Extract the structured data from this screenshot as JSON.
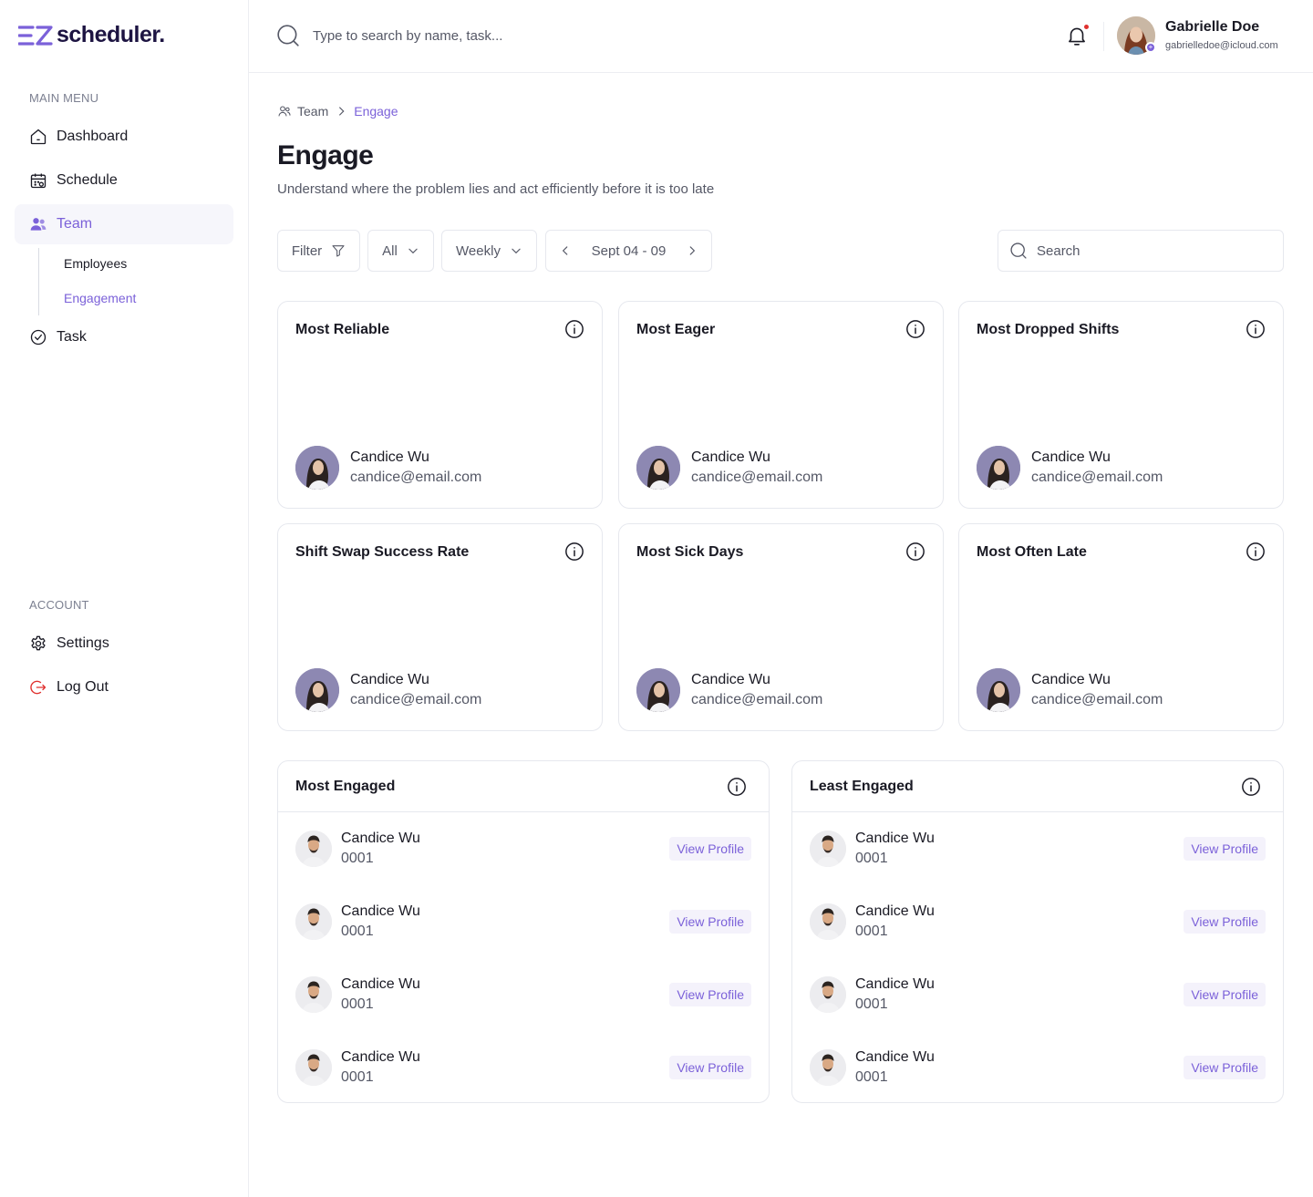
{
  "brand": {
    "name": "scheduler.",
    "accent": "#7b61d9",
    "dark": "#1d1442"
  },
  "sidebar": {
    "main_menu_label": "MAIN MENU",
    "items": [
      {
        "label": "Dashboard",
        "icon": "home-icon"
      },
      {
        "label": "Schedule",
        "icon": "calendar-icon"
      },
      {
        "label": "Team",
        "icon": "users-icon",
        "active": true
      },
      {
        "label": "Task",
        "icon": "check-circle-icon"
      }
    ],
    "team_sub": [
      {
        "label": "Employees"
      },
      {
        "label": "Engagement",
        "active": true
      }
    ],
    "account_label": "ACCOUNT",
    "account_items": [
      {
        "label": "Settings",
        "icon": "gear-icon"
      },
      {
        "label": "Log Out",
        "icon": "logout-icon"
      }
    ]
  },
  "topbar": {
    "search_placeholder": "Type to search by name, task...",
    "user": {
      "name": "Gabrielle Doe",
      "email": "gabrielledoe@icloud.com"
    }
  },
  "breadcrumb": {
    "parent": "Team",
    "current": "Engage"
  },
  "page": {
    "title": "Engage",
    "subtitle": "Understand where the problem lies and act efficiently before it is too late"
  },
  "toolbar": {
    "filter_label": "Filter",
    "group_value": "All",
    "period_value": "Weekly",
    "date_range": "Sept 04 - 09",
    "search_placeholder": "Search"
  },
  "stat_cards": [
    {
      "title": "Most Reliable",
      "name": "Candice Wu",
      "email": "candice@email.com"
    },
    {
      "title": "Most Eager",
      "name": "Candice Wu",
      "email": "candice@email.com"
    },
    {
      "title": "Most Dropped Shifts",
      "name": "Candice Wu",
      "email": "candice@email.com"
    },
    {
      "title": "Shift Swap Success Rate",
      "name": "Candice Wu",
      "email": "candice@email.com"
    },
    {
      "title": "Most Sick Days",
      "name": "Candice Wu",
      "email": "candice@email.com"
    },
    {
      "title": "Most Often Late",
      "name": "Candice Wu",
      "email": "candice@email.com"
    }
  ],
  "most_engaged": {
    "title": "Most Engaged",
    "rows": [
      {
        "name": "Candice Wu",
        "id": "0001",
        "action": "View Profile"
      },
      {
        "name": "Candice Wu",
        "id": "0001",
        "action": "View Profile"
      },
      {
        "name": "Candice Wu",
        "id": "0001",
        "action": "View Profile"
      },
      {
        "name": "Candice Wu",
        "id": "0001",
        "action": "View Profile"
      }
    ]
  },
  "least_engaged": {
    "title": "Least Engaged",
    "rows": [
      {
        "name": "Candice Wu",
        "id": "0001",
        "action": "View Profile"
      },
      {
        "name": "Candice Wu",
        "id": "0001",
        "action": "View Profile"
      },
      {
        "name": "Candice Wu",
        "id": "0001",
        "action": "View Profile"
      },
      {
        "name": "Candice Wu",
        "id": "0001",
        "action": "View Profile"
      }
    ]
  }
}
